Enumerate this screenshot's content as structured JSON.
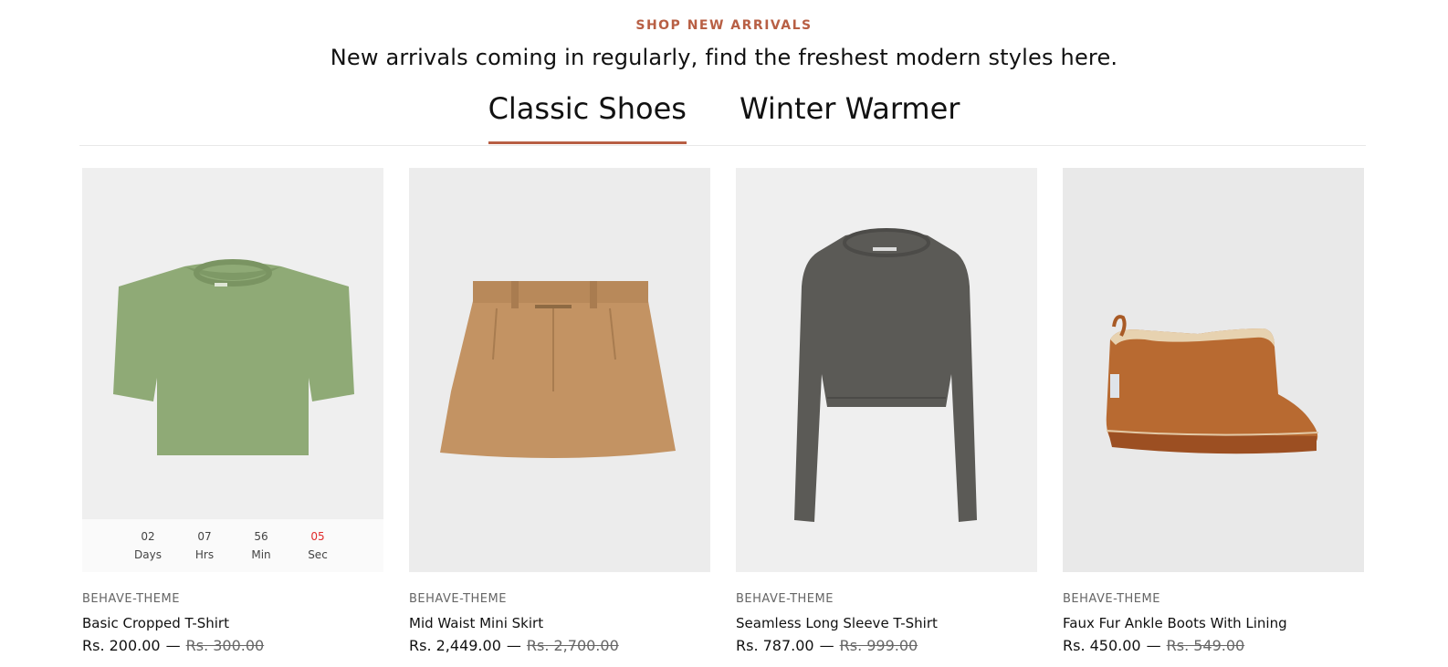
{
  "section": {
    "eyebrow": "SHOP NEW ARRIVALS",
    "subtitle": "New arrivals coming in regularly, find the freshest modern styles here."
  },
  "tabs": [
    {
      "label": "Classic Shoes",
      "active": true
    },
    {
      "label": "Winter Warmer",
      "active": false
    }
  ],
  "colors": {
    "accent": "#b85f44",
    "countdown_seconds": "#e02b2b",
    "image_bg": "#efefef"
  },
  "products": [
    {
      "vendor": "BEHAVE-THEME",
      "title": "Basic Cropped T-Shirt",
      "price": "Rs. 200.00",
      "separator": "—",
      "compare_price": "Rs. 300.00",
      "image_icon": "green-cropped-tshirt-image",
      "countdown": {
        "days": "02",
        "days_label": "Days",
        "hrs": "07",
        "hrs_label": "Hrs",
        "min": "56",
        "min_label": "Min",
        "sec": "05",
        "sec_label": "Sec"
      }
    },
    {
      "vendor": "BEHAVE-THEME",
      "title": "Mid Waist Mini Skirt",
      "price": "Rs. 2,449.00",
      "separator": "—",
      "compare_price": "Rs. 2,700.00",
      "image_icon": "tan-mini-skirt-image"
    },
    {
      "vendor": "BEHAVE-THEME",
      "title": "Seamless Long Sleeve T-Shirt",
      "price": "Rs. 787.00",
      "separator": "—",
      "compare_price": "Rs. 999.00",
      "image_icon": "grey-long-sleeve-top-image"
    },
    {
      "vendor": "BEHAVE-THEME",
      "title": "Faux Fur Ankle Boots With Lining",
      "price": "Rs. 450.00",
      "separator": "—",
      "compare_price": "Rs. 549.00",
      "image_icon": "brown-ankle-boot-image"
    }
  ]
}
